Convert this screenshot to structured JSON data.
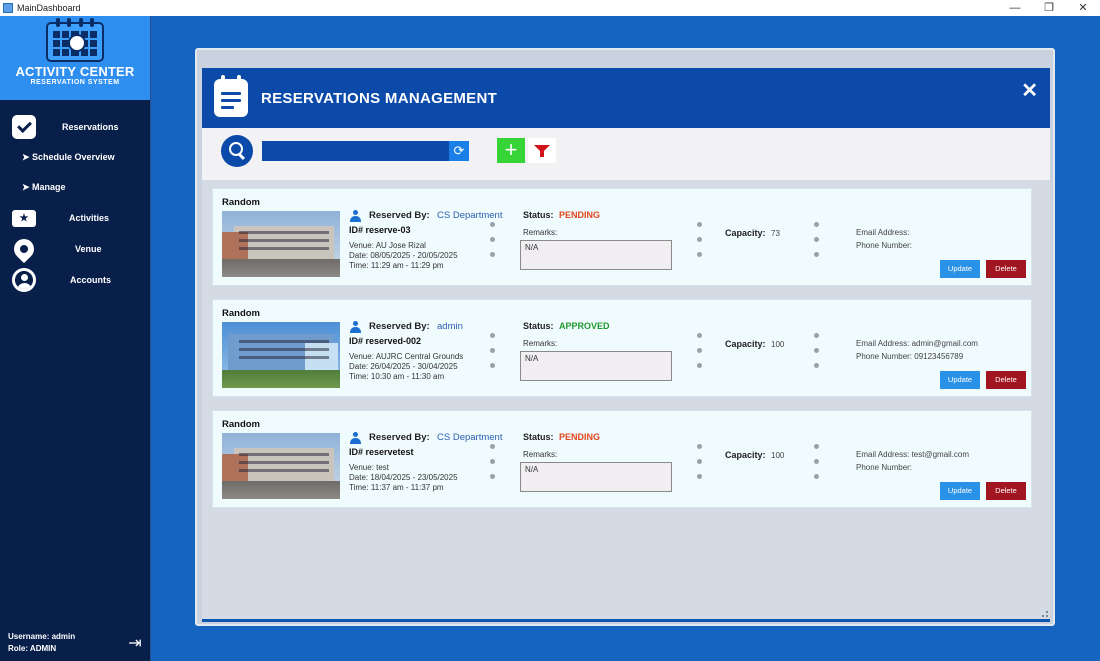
{
  "window": {
    "title": "MainDashboard",
    "controls": {
      "minimize": "—",
      "maximize": "❐",
      "close": "✕"
    }
  },
  "sidebar": {
    "logo": {
      "title": "ACTIVITY CENTER",
      "subtitle": "RESERVATION SYSTEM"
    },
    "items": [
      {
        "label": "Reservations",
        "icon": "check-icon"
      },
      {
        "label": "➤ Schedule Overview"
      },
      {
        "label": "➤ Manage"
      },
      {
        "label": "Activities",
        "icon": "ticket-icon"
      },
      {
        "label": "Venue",
        "icon": "location-pin-icon"
      },
      {
        "label": "Accounts",
        "icon": "user-circle-icon"
      }
    ],
    "user": {
      "username": "Username: admin",
      "role": "Role: ADMIN"
    }
  },
  "header": {
    "title": "RESERVATIONS MANAGEMENT",
    "close": "✕"
  },
  "toolbar": {
    "search_value": "",
    "refresh": "⟳",
    "add": "+"
  },
  "labels": {
    "reserved_by": "Reserved By:",
    "status": "Status:",
    "remarks": "Remarks:",
    "capacity": "Capacity:",
    "update": "Update",
    "delete": "Delete"
  },
  "reservations": [
    {
      "title": "Random",
      "reserved_by": "CS Department",
      "id": "ID# reserve-03",
      "venue": "Venue: AU Jose Rizal",
      "date": "Date: 08/05/2025 - 20/05/2025",
      "time": "Time: 11:29 am - 11:29 pm",
      "status": "PENDING",
      "status_color": "#e2461d",
      "remarks": "N/A",
      "capacity": "73",
      "email": "Email Address:",
      "phone": "Phone Number:"
    },
    {
      "title": "Random",
      "reserved_by": "admin",
      "id": "ID# reserved-002",
      "venue": "Venue: AUJRC Central Grounds",
      "date": "Date: 26/04/2025 - 30/04/2025",
      "time": "Time: 10:30 am - 11:30 am",
      "status": "APPROVED",
      "status_color": "#1e9b2f",
      "remarks": "N/A",
      "capacity": "100",
      "email": "Email Address: admin@gmail.com",
      "phone": "Phone Number: 09123456789"
    },
    {
      "title": "Random",
      "reserved_by": "CS Department",
      "id": "ID# reservetest",
      "venue": "Venue: test",
      "date": "Date: 18/04/2025 - 23/05/2025",
      "time": "Time: 11:37 am - 11:37 pm",
      "status": "PENDING",
      "status_color": "#e2461d",
      "remarks": "N/A",
      "capacity": "100",
      "email": "Email Address: test@gmail.com",
      "phone": "Phone Number:"
    }
  ]
}
